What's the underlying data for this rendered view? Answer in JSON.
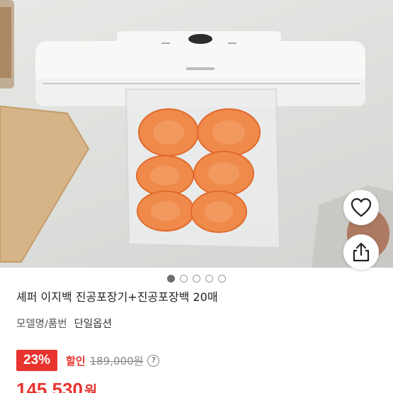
{
  "product": {
    "title": "셰퍼 이지백 진공포장기+진공포장백 20매",
    "model_label": "모델명/품번",
    "model_value": "단일옵션"
  },
  "gallery": {
    "total_images": 5,
    "active_index": 0
  },
  "actions": {
    "like_icon": "heart-outline-icon",
    "share_icon": "share-icon"
  },
  "pricing": {
    "discount_percent": "23%",
    "sale_label": "할인",
    "original_price": "189,000원",
    "sale_price": "145,530",
    "currency": "원",
    "accent_color": "#e8332e"
  }
}
